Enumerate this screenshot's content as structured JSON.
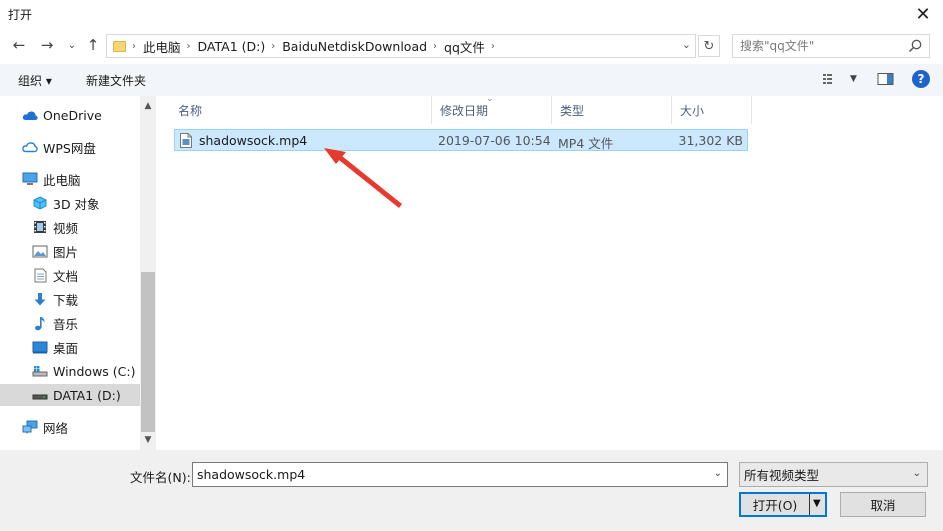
{
  "window": {
    "title": "打开",
    "close_glyph": "✕"
  },
  "nav": {
    "back_glyph": "←",
    "forward_glyph": "→",
    "recent_glyph": "⌄",
    "up_glyph": "↑",
    "breadcrumb": [
      "此电脑",
      "DATA1 (D:)",
      "BaiduNetdiskDownload",
      "qq文件"
    ],
    "separator": "›",
    "refresh_glyph": "↻",
    "search_placeholder": "搜索\"qq文件\""
  },
  "toolbar": {
    "organize_label": "组织 ▾",
    "new_folder_label": "新建文件夹",
    "help_glyph": "?"
  },
  "sidebar": {
    "items": [
      {
        "label": "OneDrive",
        "icon": "onedrive-cloud-icon"
      },
      {
        "label": "WPS网盘",
        "icon": "wps-cloud-icon"
      },
      {
        "label": "此电脑",
        "icon": "computer-icon"
      },
      {
        "label": "3D 对象",
        "icon": "3d-objects-icon"
      },
      {
        "label": "视频",
        "icon": "video-icon"
      },
      {
        "label": "图片",
        "icon": "picture-icon"
      },
      {
        "label": "文档",
        "icon": "document-icon"
      },
      {
        "label": "下载",
        "icon": "download-icon"
      },
      {
        "label": "音乐",
        "icon": "music-icon"
      },
      {
        "label": "桌面",
        "icon": "desktop-icon"
      },
      {
        "label": "Windows (C:)",
        "icon": "drive-c-icon"
      },
      {
        "label": "DATA1 (D:)",
        "icon": "drive-d-icon",
        "selected": true
      },
      {
        "label": "网络",
        "icon": "network-icon"
      }
    ]
  },
  "columns": [
    "名称",
    "修改日期",
    "类型",
    "大小"
  ],
  "files": [
    {
      "name": "shadowsock.mp4",
      "modified": "2019-07-06 10:54",
      "type": "MP4 文件",
      "size": "31,302 KB"
    }
  ],
  "bottom": {
    "filename_label": "文件名(N):",
    "filename_value": "shadowsock.mp4",
    "filetype_value": "所有视频类型",
    "open_label": "打开(O)",
    "cancel_label": "取消"
  },
  "colors": {
    "accent": "#0078d7",
    "selection": "#cce8ff",
    "arrow": "#e8392f"
  }
}
